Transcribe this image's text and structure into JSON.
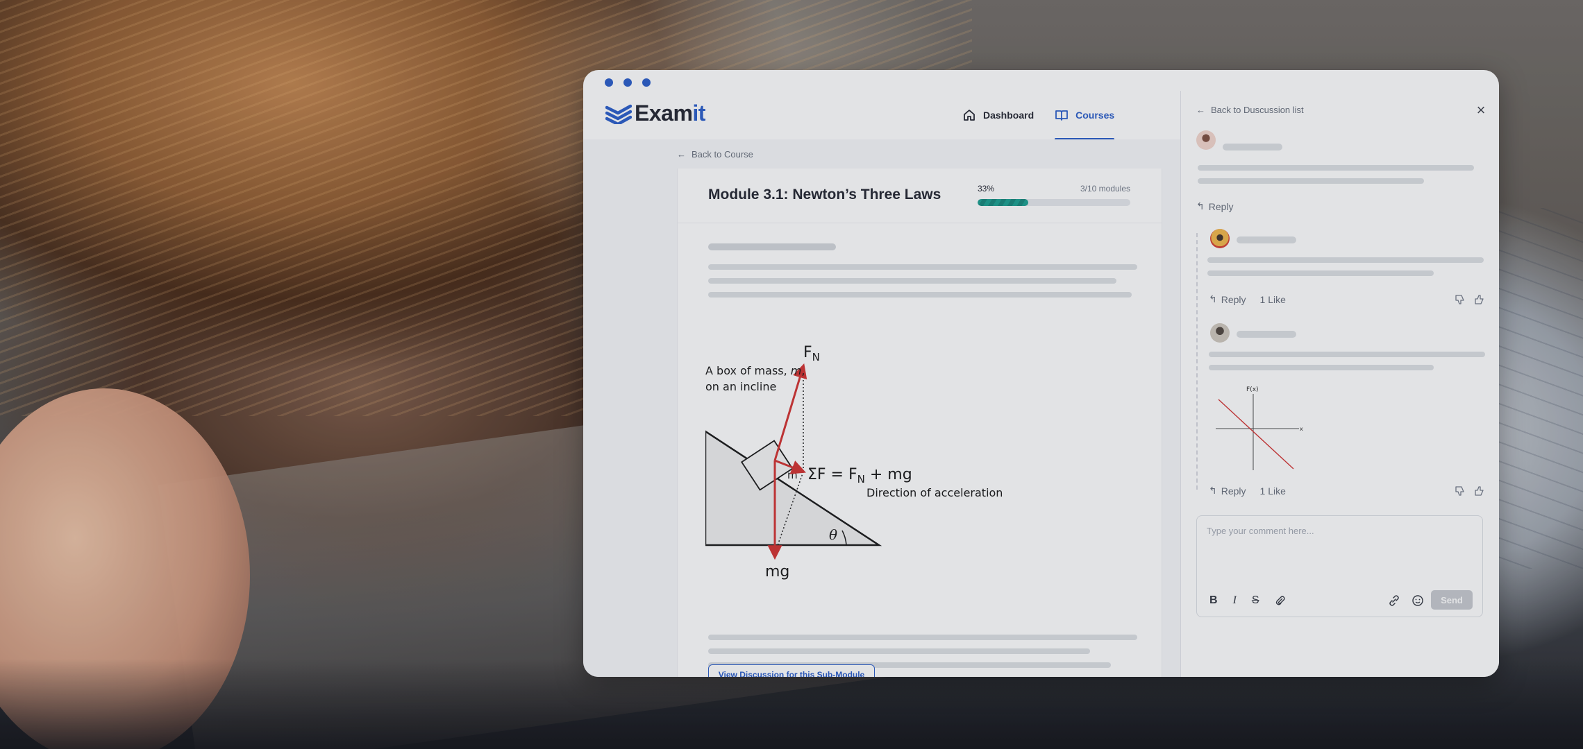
{
  "brand": {
    "logo_text_prefix": "Exam",
    "logo_text_suffix": "it",
    "accent": "#2358c9"
  },
  "nav": {
    "items": [
      {
        "label": "Dashboard",
        "icon": "home-icon",
        "active": false
      },
      {
        "label": "Courses",
        "icon": "book-icon",
        "active": true
      }
    ]
  },
  "course": {
    "back_label": "Back to Course",
    "module_title": "Module 3.1: Newton’s Three Laws",
    "progress": {
      "percent_label": "33%",
      "value": 0.33,
      "modules_label": "3/10 modules",
      "fill_color": "#139c8e"
    },
    "diagram": {
      "caption_line1": "A box of mass,",
      "caption_mass": "m",
      "caption_comma": ",",
      "caption_line2": "on an incline",
      "box_label": "m",
      "normal_force_main": "F",
      "normal_force_sub": "N",
      "net_force_prefix": "ΣF = F",
      "net_force_sub": "N",
      "net_force_suffix": " + mg",
      "direction_label": "Direction of acceleration",
      "angle_label": "θ",
      "weight_label": "mg",
      "arrow_color": "#d22b2b"
    },
    "discussion_button": "View Discussion for this Sub-Module"
  },
  "discussion": {
    "back_label": "Back to Duscussion list",
    "reply_label": "Reply",
    "comments": [
      {
        "reply": "Reply",
        "likes": "1 Like"
      },
      {
        "reply": "Reply",
        "likes": "1 Like",
        "graph_y_label": "F(x)",
        "graph_x_label": "x"
      }
    ],
    "composer": {
      "placeholder": "Type your comment here...",
      "send_label": "Send"
    }
  }
}
